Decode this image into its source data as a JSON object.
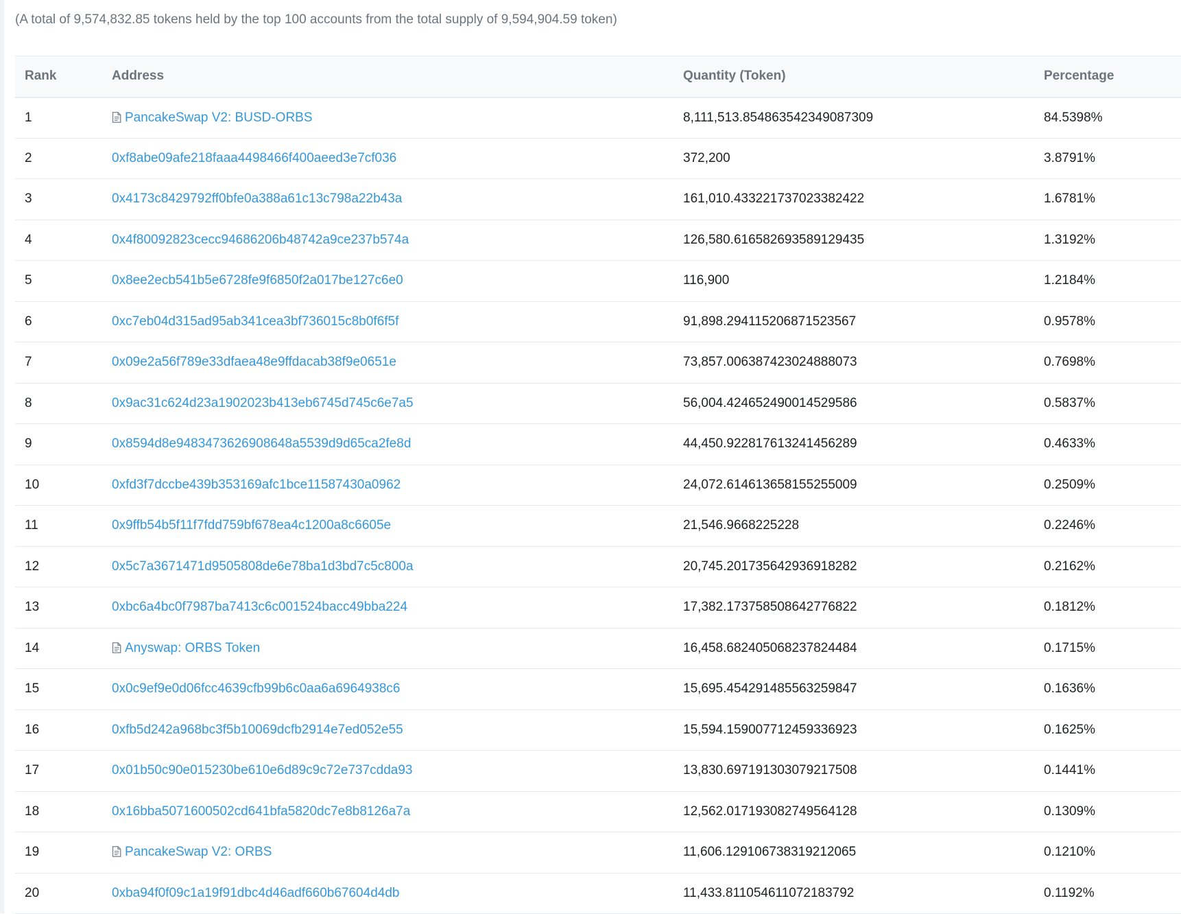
{
  "summary": "(A total of 9,574,832.85 tokens held by the top 100 accounts from the total supply of 9,594,904.59 token)",
  "table": {
    "headers": {
      "rank": "Rank",
      "address": "Address",
      "quantity": "Quantity (Token)",
      "percentage": "Percentage"
    },
    "rows": [
      {
        "rank": "1",
        "address": "PancakeSwap V2: BUSD-ORBS",
        "contract": true,
        "quantity": "8,111,513.854863542349087309",
        "percentage": "84.5398%"
      },
      {
        "rank": "2",
        "address": "0xf8abe09afe218faaa4498466f400aeed3e7cf036",
        "contract": false,
        "quantity": "372,200",
        "percentage": "3.8791%"
      },
      {
        "rank": "3",
        "address": "0x4173c8429792ff0bfe0a388a61c13c798a22b43a",
        "contract": false,
        "quantity": "161,010.433221737023382422",
        "percentage": "1.6781%"
      },
      {
        "rank": "4",
        "address": "0x4f80092823cecc94686206b48742a9ce237b574a",
        "contract": false,
        "quantity": "126,580.616582693589129435",
        "percentage": "1.3192%"
      },
      {
        "rank": "5",
        "address": "0x8ee2ecb541b5e6728fe9f6850f2a017be127c6e0",
        "contract": false,
        "quantity": "116,900",
        "percentage": "1.2184%"
      },
      {
        "rank": "6",
        "address": "0xc7eb04d315ad95ab341cea3bf736015c8b0f6f5f",
        "contract": false,
        "quantity": "91,898.294115206871523567",
        "percentage": "0.9578%"
      },
      {
        "rank": "7",
        "address": "0x09e2a56f789e33dfaea48e9ffdacab38f9e0651e",
        "contract": false,
        "quantity": "73,857.006387423024888073",
        "percentage": "0.7698%"
      },
      {
        "rank": "8",
        "address": "0x9ac31c624d23a1902023b413eb6745d745c6e7a5",
        "contract": false,
        "quantity": "56,004.424652490014529586",
        "percentage": "0.5837%"
      },
      {
        "rank": "9",
        "address": "0x8594d8e9483473626908648a5539d9d65ca2fe8d",
        "contract": false,
        "quantity": "44,450.922817613241456289",
        "percentage": "0.4633%"
      },
      {
        "rank": "10",
        "address": "0xfd3f7dccbe439b353169afc1bce11587430a0962",
        "contract": false,
        "quantity": "24,072.614613658155255009",
        "percentage": "0.2509%"
      },
      {
        "rank": "11",
        "address": "0x9ffb54b5f11f7fdd759bf678ea4c1200a8c6605e",
        "contract": false,
        "quantity": "21,546.9668225228",
        "percentage": "0.2246%"
      },
      {
        "rank": "12",
        "address": "0x5c7a3671471d9505808de6e78ba1d3bd7c5c800a",
        "contract": false,
        "quantity": "20,745.201735642936918282",
        "percentage": "0.2162%"
      },
      {
        "rank": "13",
        "address": "0xbc6a4bc0f7987ba7413c6c001524bacc49bba224",
        "contract": false,
        "quantity": "17,382.173758508642776822",
        "percentage": "0.1812%"
      },
      {
        "rank": "14",
        "address": "Anyswap: ORBS Token",
        "contract": true,
        "quantity": "16,458.682405068237824484",
        "percentage": "0.1715%"
      },
      {
        "rank": "15",
        "address": "0x0c9ef9e0d06fcc4639cfb99b6c0aa6a6964938c6",
        "contract": false,
        "quantity": "15,695.454291485563259847",
        "percentage": "0.1636%"
      },
      {
        "rank": "16",
        "address": "0xfb5d242a968bc3f5b10069dcfb2914e7ed052e55",
        "contract": false,
        "quantity": "15,594.159007712459336923",
        "percentage": "0.1625%"
      },
      {
        "rank": "17",
        "address": "0x01b50c90e015230be610e6d89c9c72e737cdda93",
        "contract": false,
        "quantity": "13,830.697191303079217508",
        "percentage": "0.1441%"
      },
      {
        "rank": "18",
        "address": "0x16bba5071600502cd641bfa5820dc7e8b8126a7a",
        "contract": false,
        "quantity": "12,562.017193082749564128",
        "percentage": "0.1309%"
      },
      {
        "rank": "19",
        "address": "PancakeSwap V2: ORBS",
        "contract": true,
        "quantity": "11,606.129106738319212065",
        "percentage": "0.1210%"
      },
      {
        "rank": "20",
        "address": "0xba94f0f09c1a19f91dbc4d46adf660b67604d4db",
        "contract": false,
        "quantity": "11,433.811054611072183792",
        "percentage": "0.1192%"
      }
    ]
  },
  "colors": {
    "link": "#3498db",
    "muted_text": "#6c757e",
    "body_text": "#1e2022",
    "border": "#e7eaf3",
    "header_bg": "#f8f9fa"
  },
  "icons": {
    "contract": "file-contract-icon"
  }
}
